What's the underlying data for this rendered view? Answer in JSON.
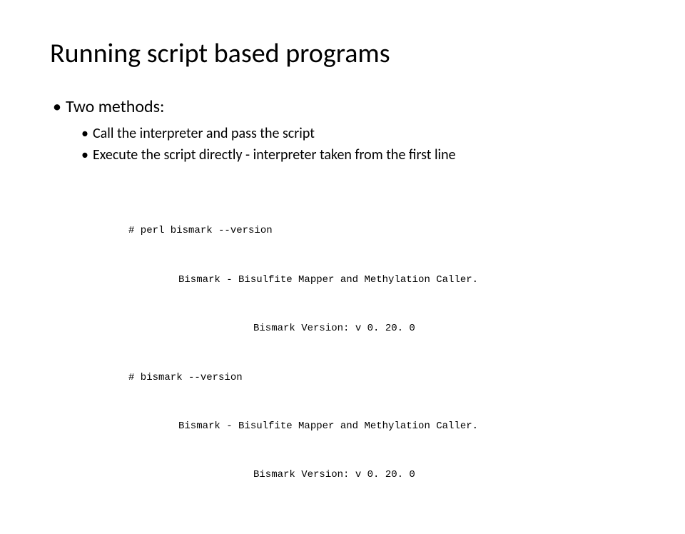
{
  "title": "Running script based programs",
  "bullet": {
    "heading": "Two methods:",
    "subs": [
      "Call the interpreter and pass the script",
      "Execute the script directly - interpreter taken from the first line"
    ]
  },
  "code": {
    "lines": [
      "# perl bismark --version",
      "Bismark - Bisulfite Mapper and Methylation Caller.",
      "Bismark Version: v 0. 20. 0",
      "# bismark --version",
      "Bismark - Bisulfite Mapper and Methylation Caller.",
      "Bismark Version: v 0. 20. 0"
    ]
  }
}
